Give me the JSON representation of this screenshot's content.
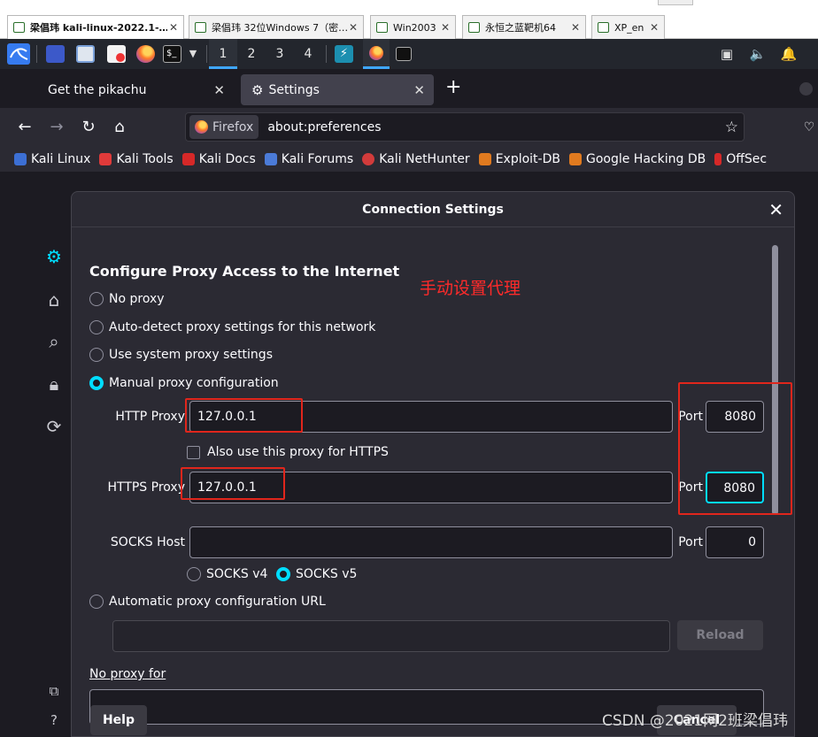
{
  "vm_tabs": [
    {
      "label": "梁倡玮 kali-linux-2022.1-…",
      "active": true
    },
    {
      "label": "梁倡玮 32位Windows 7（密…",
      "active": false
    },
    {
      "label": "Win2003",
      "active": false
    },
    {
      "label": "永恒之蓝靶机64",
      "active": false
    },
    {
      "label": "XP_en",
      "active": false
    }
  ],
  "workspaces": [
    "1",
    "2",
    "3",
    "4"
  ],
  "browser_tabs": [
    {
      "label": "Get the pikachu"
    },
    {
      "label": "Settings"
    }
  ],
  "url": {
    "identity": "Firefox",
    "text": "about:preferences"
  },
  "bookmarks": [
    {
      "label": "Kali Linux",
      "color": "#3c6fd4"
    },
    {
      "label": "Kali Tools",
      "color": "#e03a3a"
    },
    {
      "label": "Kali Docs",
      "color": "#d62828"
    },
    {
      "label": "Kali Forums",
      "color": "#4b7bd8"
    },
    {
      "label": "Kali NetHunter",
      "color": "#d23b3b"
    },
    {
      "label": "Exploit-DB",
      "color": "#e07a1f"
    },
    {
      "label": "Google Hacking DB",
      "color": "#e07a1f"
    },
    {
      "label": "OffSec",
      "color": "#d62828"
    }
  ],
  "dialog": {
    "title": "Connection Settings",
    "heading": "Configure Proxy Access to the Internet",
    "annotation": "手动设置代理",
    "options": {
      "no_proxy": "No proxy",
      "auto_detect": "Auto-detect proxy settings for this network",
      "system": "Use system proxy settings",
      "manual": "Manual proxy configuration",
      "pac": "Automatic proxy configuration URL"
    },
    "selected_option": "manual",
    "http_proxy": {
      "label": "HTTP Proxy",
      "value": "127.0.0.1",
      "port_label": "Port",
      "port": "8080"
    },
    "also_https": {
      "label": "Also use this proxy for HTTPS",
      "checked": false
    },
    "https_proxy": {
      "label": "HTTPS Proxy",
      "value": "127.0.0.1",
      "port_label": "Port",
      "port": "8080"
    },
    "socks": {
      "label": "SOCKS Host",
      "value": "",
      "port_label": "Port",
      "port": "0",
      "v4": "SOCKS v4",
      "v5": "SOCKS v5",
      "selected": "v5"
    },
    "pac_url": "",
    "reload_label": "Reload",
    "no_proxy_for": "No proxy for",
    "help_label": "Help",
    "cancel_label": "Cancel"
  },
  "watermark": "CSDN @2021网2班梁倡玮",
  "colors": {
    "accent": "#00ddff",
    "annotation": "#e0261c"
  }
}
